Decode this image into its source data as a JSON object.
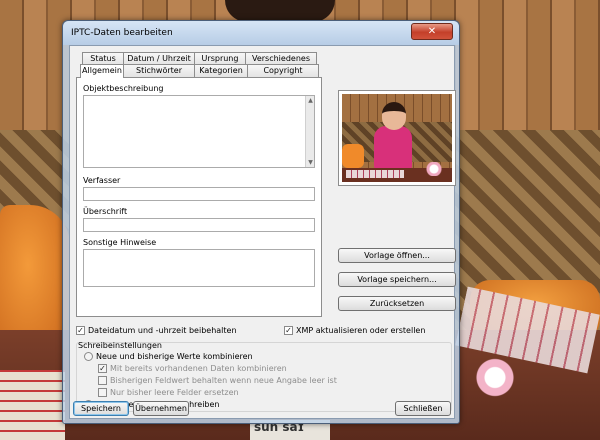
{
  "window": {
    "title": "IPTC-Daten bearbeiten",
    "close_glyph": "✕"
  },
  "tabs": {
    "back_row": [
      "Status",
      "Datum / Uhrzeit",
      "Ursprung",
      "Verschiedenes"
    ],
    "front_row": [
      "Allgemein",
      "Stichwörter",
      "Kategorien",
      "Copyright"
    ],
    "active": "Allgemein"
  },
  "fields": {
    "objektbeschreibung_label": "Objektbeschreibung",
    "objektbeschreibung_value": "",
    "verfasser_label": "Verfasser",
    "verfasser_value": "",
    "ueberschrift_label": "Überschrift",
    "ueberschrift_value": "",
    "hinweise_label": "Sonstige Hinweise",
    "hinweise_value": ""
  },
  "side_buttons": {
    "open_template": "Vorlage öffnen...",
    "save_template": "Vorlage speichern...",
    "reset": "Zurücksetzen"
  },
  "options": {
    "keep_file_date": "Dateidatum und -uhrzeit beibehalten",
    "keep_file_date_checked": true,
    "update_xmp": "XMP aktualisieren oder erstellen",
    "update_xmp_checked": true
  },
  "write_settings": {
    "group_label": "Schreibeinstellungen",
    "combine": "Neue und bisherige Werte kombinieren",
    "combine_selected": false,
    "combine_existing": "Mit bereits vorhandenen Daten kombinieren",
    "combine_existing_checked": true,
    "keep_old_if_empty": "Bisherigen Feldwert behalten wenn neue Angabe leer ist",
    "keep_old_if_empty_checked": false,
    "only_empty": "Nur bisher leere Felder ersetzen",
    "only_empty_checked": false,
    "overwrite": "Bisherige Werte überschreiben",
    "overwrite_selected": true
  },
  "bottom_buttons": {
    "save": "Speichern",
    "apply": "Übernehmen",
    "close": "Schließen"
  },
  "background": {
    "newspaper_text": "sun saɪ"
  }
}
